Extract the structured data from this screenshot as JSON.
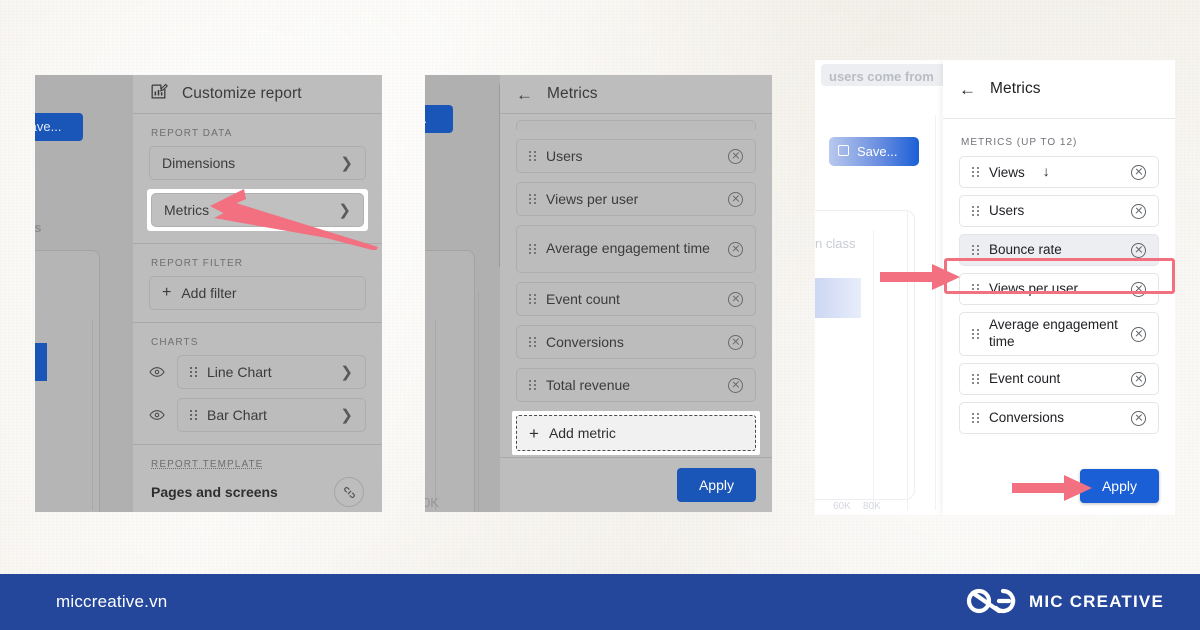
{
  "footer": {
    "site": "miccreative.vn",
    "brand_name": "MIC CREATIVE",
    "bg_color": "#24479b",
    "logo_icon": "infinity-loops-icon"
  },
  "panel1": {
    "header": {
      "title": "Customize report",
      "icon": "edit-chart-icon"
    },
    "sections": [
      {
        "label": "REPORT DATA",
        "rows": [
          {
            "label": "Dimensions",
            "trailing_icon": "chevron-right-icon",
            "highlighted": false
          },
          {
            "label": "Metrics",
            "trailing_icon": "chevron-right-icon",
            "highlighted": true
          }
        ]
      },
      {
        "label": "REPORT FILTER",
        "rows": [
          {
            "label": "Add filter",
            "leading_icon": "plus-icon"
          }
        ]
      },
      {
        "label": "CHARTS",
        "rows": [
          {
            "label": "Line Chart",
            "leading_icon": "eye-icon",
            "drag_icon": "drag-handle-icon",
            "trailing_icon": "chevron-right-icon"
          },
          {
            "label": "Bar Chart",
            "leading_icon": "eye-icon",
            "drag_icon": "drag-handle-icon",
            "trailing_icon": "chevron-right-icon"
          }
        ]
      },
      {
        "label": "REPORT TEMPLATE",
        "rows": [
          {
            "label": "Pages and screens",
            "trailing_icon": "link-template-icon"
          }
        ]
      }
    ],
    "background": {
      "save_label": "Save...",
      "ghost_text": "ss"
    }
  },
  "panel2": {
    "header": {
      "title": "Metrics",
      "back_icon": "back-arrow-icon"
    },
    "metrics": [
      {
        "label": "Users"
      },
      {
        "label": "Views per user"
      },
      {
        "label": "Average engagement time"
      },
      {
        "label": "Event count"
      },
      {
        "label": "Conversions"
      },
      {
        "label": "Total revenue"
      }
    ],
    "add_metric_label": "Add metric",
    "apply_label": "Apply",
    "background": {
      "save_label": "e...",
      "axis_label": "0K"
    }
  },
  "panel3": {
    "header": {
      "title": "Metrics",
      "back_icon": "back-arrow-icon"
    },
    "section_label": "METRICS (UP TO 12)",
    "metrics": [
      {
        "label": "Views",
        "sort_icon": "arrow-down-icon",
        "selected": false
      },
      {
        "label": "Users",
        "selected": false
      },
      {
        "label": "Bounce rate",
        "selected": true
      },
      {
        "label": "Views per user",
        "selected": false
      },
      {
        "label": "Average engagement time",
        "selected": false
      },
      {
        "label": "Event count",
        "selected": false
      },
      {
        "label": "Conversions",
        "selected": false
      }
    ],
    "apply_label": "Apply",
    "background": {
      "ghost_pill": "users come from",
      "save_label": "Save...",
      "ghost_text": "n class",
      "axis_labels": [
        "60K",
        "80K"
      ],
      "top_icons": [
        "compare-icon",
        "share-icon",
        "more-vert-icon",
        "record-icon"
      ]
    }
  },
  "annotations": {
    "arrow_color": "#f2707f",
    "highlight_box_color": "#f2707f",
    "arrows": [
      {
        "name": "arrow-to-metrics",
        "target": "panel1 Metrics row"
      },
      {
        "name": "arrow-to-bounce-rate",
        "target": "panel3 Bounce rate row"
      },
      {
        "name": "arrow-to-apply",
        "target": "panel3 Apply button"
      }
    ]
  }
}
